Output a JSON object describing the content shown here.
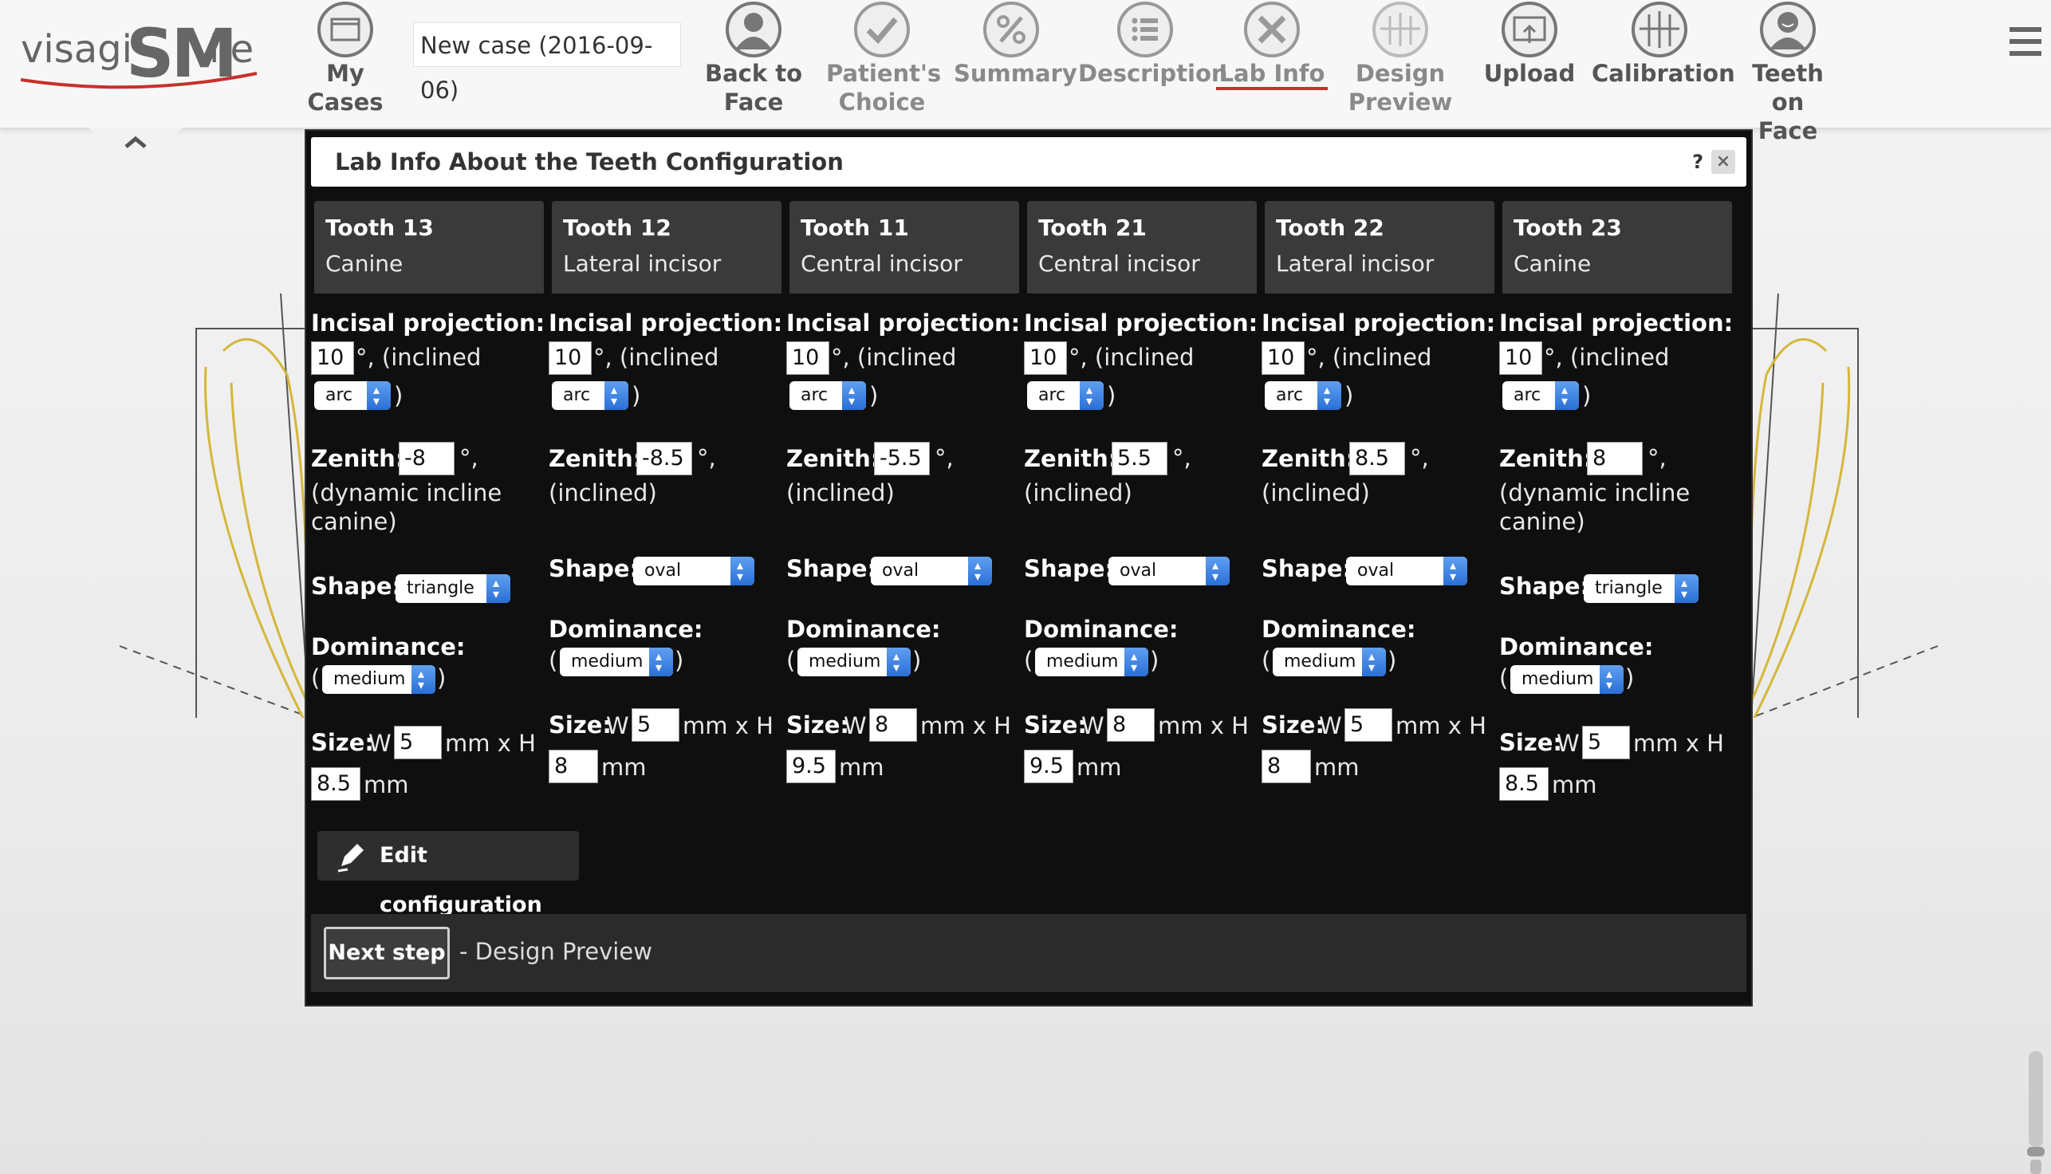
{
  "app": {
    "logo": {
      "part1": "visagi",
      "part2": "SM",
      "part3": "ile"
    },
    "case_name": "New case (2016-09-06)"
  },
  "nav": [
    {
      "id": "my-cases",
      "line1": "My Cases",
      "line2": "",
      "icon": "folder-icon",
      "muted": false
    },
    {
      "id": "back-to-face",
      "line1": "Back to",
      "line2": "Face",
      "icon": "user-icon",
      "muted": false
    },
    {
      "id": "patients-choice",
      "line1": "Patient's",
      "line2": "Choice",
      "icon": "check-icon",
      "muted": true
    },
    {
      "id": "summary",
      "line1": "Summary",
      "line2": "",
      "icon": "percent-icon",
      "muted": true
    },
    {
      "id": "description",
      "line1": "Description",
      "line2": "",
      "icon": "list-icon",
      "muted": true
    },
    {
      "id": "lab-info",
      "line1": "Lab Info",
      "line2": "",
      "icon": "tools-icon",
      "muted": true,
      "active": true
    },
    {
      "id": "design-preview",
      "line1": "Design",
      "line2": "Preview",
      "icon": "teeth-icon",
      "muted": true
    },
    {
      "id": "upload",
      "line1": "Upload",
      "line2": "",
      "icon": "upload-icon",
      "muted": false
    },
    {
      "id": "calibration",
      "line1": "Calibration",
      "line2": "",
      "icon": "teeth-icon",
      "muted": false
    },
    {
      "id": "teeth-on-face",
      "line1": "Teeth on",
      "line2": "Face",
      "icon": "face-icon",
      "muted": false
    }
  ],
  "dialog": {
    "title": "Lab Info About the Teeth Configuration",
    "help": "?",
    "close": "×",
    "labels": {
      "incisal": "Incisal projection:",
      "inclined_suffix": "°, (inclined",
      "close_paren": ")",
      "open_paren": "(",
      "zenith": "Zenith:",
      "degree_comma": "°,",
      "shape": "Shape:",
      "dominance": "Dominance:",
      "size": "Size:",
      "w": "W",
      "mm_x_h": "mm x H",
      "mm": "mm"
    },
    "teeth": [
      {
        "name": "Tooth 13",
        "type": "Canine",
        "incisal": "10",
        "incisal_dir": "arc",
        "zenith": "-8",
        "zenith_note_1": "(dynamic incline",
        "zenith_note_2": "canine)",
        "shape": "triangle",
        "dominance": "medium",
        "width": "5",
        "height": "8.5"
      },
      {
        "name": "Tooth 12",
        "type": "Lateral incisor",
        "incisal": "10",
        "incisal_dir": "arc",
        "zenith": "-8.5",
        "zenith_note_1": "(inclined)",
        "zenith_note_2": "",
        "shape": "oval",
        "dominance": "medium",
        "width": "5",
        "height": "8"
      },
      {
        "name": "Tooth 11",
        "type": "Central incisor",
        "incisal": "10",
        "incisal_dir": "arc",
        "zenith": "-5.5",
        "zenith_note_1": "(inclined)",
        "zenith_note_2": "",
        "shape": "oval",
        "dominance": "medium",
        "width": "8",
        "height": "9.5"
      },
      {
        "name": "Tooth 21",
        "type": "Central incisor",
        "incisal": "10",
        "incisal_dir": "arc",
        "zenith": "5.5",
        "zenith_note_1": "(inclined)",
        "zenith_note_2": "",
        "shape": "oval",
        "dominance": "medium",
        "width": "8",
        "height": "9.5"
      },
      {
        "name": "Tooth 22",
        "type": "Lateral incisor",
        "incisal": "10",
        "incisal_dir": "arc",
        "zenith": "8.5",
        "zenith_note_1": "(inclined)",
        "zenith_note_2": "",
        "shape": "oval",
        "dominance": "medium",
        "width": "5",
        "height": "8"
      },
      {
        "name": "Tooth 23",
        "type": "Canine",
        "incisal": "10",
        "incisal_dir": "arc",
        "zenith": "8",
        "zenith_note_1": "(dynamic incline",
        "zenith_note_2": "canine)",
        "shape": "triangle",
        "dominance": "medium",
        "width": "5",
        "height": "8.5"
      }
    ],
    "edit_button": "Edit configuration",
    "next_button": "Next step",
    "next_text": "- Design Preview"
  },
  "colors": {
    "accent_underline": "#c9302c",
    "select_blue": "#2a6fd6"
  }
}
